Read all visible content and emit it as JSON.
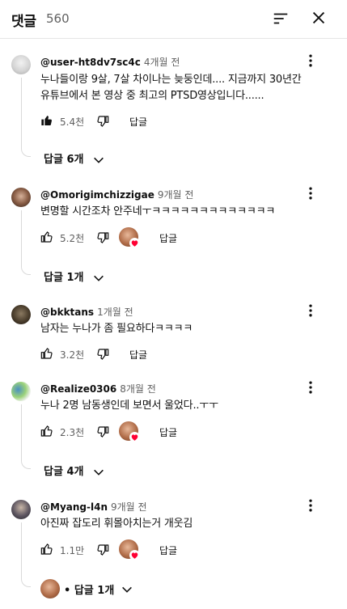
{
  "header": {
    "title": "댓글",
    "count": "560"
  },
  "comments": [
    {
      "handle": "@user-ht8dv7sc4c",
      "time": "4개월 전",
      "lines": [
        "누나들이랑 9살, 7살 차이나는 늦둥인데.... 지금까지 30년간",
        "유튜브에서 본 영상 중 최고의 PTSD영상입니다......"
      ],
      "likes": "5.4천",
      "liked": true,
      "creator_heart": false,
      "reply_label": "답글",
      "replies": "답글 6개"
    },
    {
      "handle": "@Omorigimchizzigae",
      "time": "9개월 전",
      "lines": [
        "변명할 시간조차 안주네ㅜㅋㅋㅋㅋㅋㅋㅋㅋㅋㅋㅋㅋㅋ"
      ],
      "likes": "5.2천",
      "liked": false,
      "creator_heart": true,
      "reply_label": "답글",
      "replies": "답글 1개"
    },
    {
      "handle": "@bkktans",
      "time": "1개월 전",
      "lines": [
        "남자는 누나가 좀 필요하다ㅋㅋㅋㅋ"
      ],
      "likes": "3.2천",
      "liked": false,
      "creator_heart": false,
      "reply_label": "답글",
      "replies": ""
    },
    {
      "handle": "@Realize0306",
      "time": "8개월 전",
      "lines": [
        "누나 2명 남동생인데 보면서 울었다..ㅜㅜ"
      ],
      "likes": "2.3천",
      "liked": false,
      "creator_heart": true,
      "reply_label": "답글",
      "replies": "답글 4개"
    },
    {
      "handle": "@Myang-l4n",
      "time": "9개월 전",
      "lines": [
        "아진짜 잡도리 휘몰아치는거 개웃김"
      ],
      "likes": "1.1만",
      "liked": false,
      "creator_heart": true,
      "reply_label": "답글",
      "replies": "• 답글 1개"
    }
  ],
  "colors": {
    "text": "#0f0f0f",
    "secondary": "#606060",
    "heart": "#ff0033",
    "divider": "#e5e5e5"
  },
  "icons": {
    "sort": "sort-icon",
    "close": "close-icon",
    "more": "more-vert-icon",
    "like": "thumb-up-icon",
    "dislike": "thumb-down-icon",
    "chevron": "chevron-down-icon",
    "heart": "heart-icon"
  }
}
